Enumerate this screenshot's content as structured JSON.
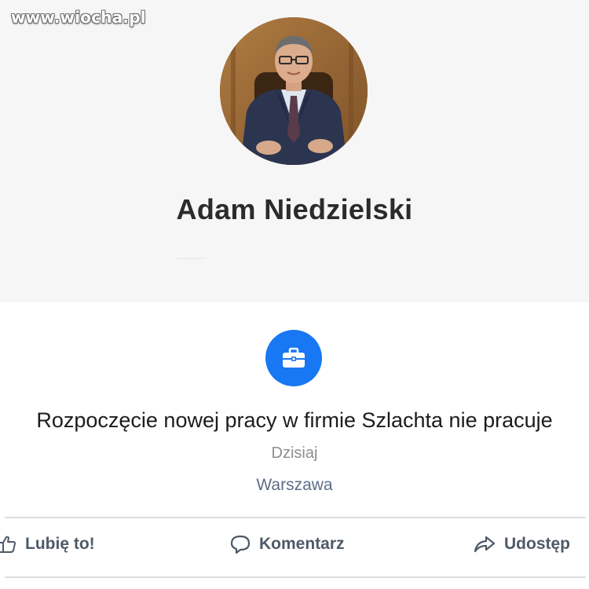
{
  "watermark": "www.wiocha.pl",
  "profile": {
    "name": "Adam Niedzielski"
  },
  "event": {
    "icon": "briefcase-icon",
    "title": "Rozpoczęcie nowej pracy w firmie Szlachta nie pracuje",
    "date": "Dzisiaj",
    "location": "Warszawa"
  },
  "actions": {
    "like_label": "Lubię to!",
    "comment_label": "Komentarz",
    "share_label": "Udostęp"
  },
  "colors": {
    "accent": "#1877f2",
    "text_dark": "#1c1c1e",
    "text_muted": "#8a8d91",
    "location": "#5d6e87",
    "action_text": "#4f5a67"
  }
}
